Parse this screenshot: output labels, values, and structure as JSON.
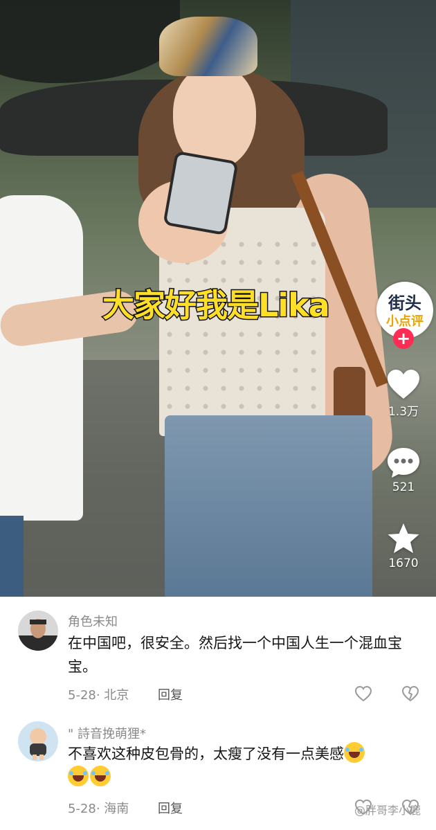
{
  "video": {
    "caption": "大家好我是Lika",
    "channel_avatar_line1": "街头",
    "channel_avatar_line2": "小点评",
    "follow_symbol": "+",
    "likes_count": "1.3万",
    "comments_count": "521",
    "favorites_count": "1670"
  },
  "comments": [
    {
      "name": "角色未知",
      "text": "在中国吧，很安全。然后找一个中国人生一个混血宝宝。",
      "date_location": "5-28· 北京",
      "reply_label": "回复"
    },
    {
      "name": "\" 詩音挽萌狸*",
      "text": "不喜欢这种皮包骨的，太瘦了没有一点美感",
      "date_location": "5-28· 海南",
      "reply_label": "回复"
    }
  ],
  "watermark": "@胖哥李小鹿",
  "colors": {
    "caption_fill": "#ffde27",
    "follow_red": "#fe2c55",
    "meta_gray": "#8a8a8a"
  },
  "icons": [
    "heart-icon",
    "comment-bubble-icon",
    "star-icon",
    "like-outline-icon",
    "dislike-outline-icon",
    "laughing-crying-emoji",
    "weibo-icon"
  ]
}
